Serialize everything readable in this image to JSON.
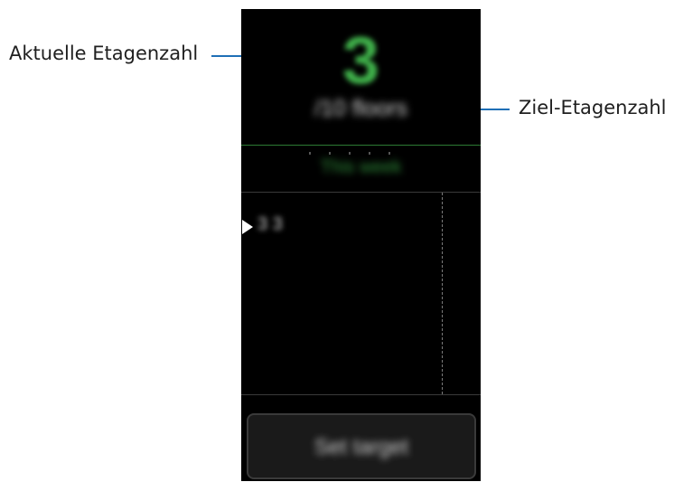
{
  "callouts": {
    "current_floors": "Aktuelle Etagenzahl",
    "target_floors": "Ziel-Etagenzahl"
  },
  "screen": {
    "current_value": "3",
    "goal_text": "/10 floors",
    "period_label": "This week",
    "chart_marker_value": "3 3",
    "set_target_label": "Set target"
  },
  "colors": {
    "accent_green": "#3fb04a",
    "callout_line": "#1f6fb6",
    "screen_background": "#000000"
  }
}
